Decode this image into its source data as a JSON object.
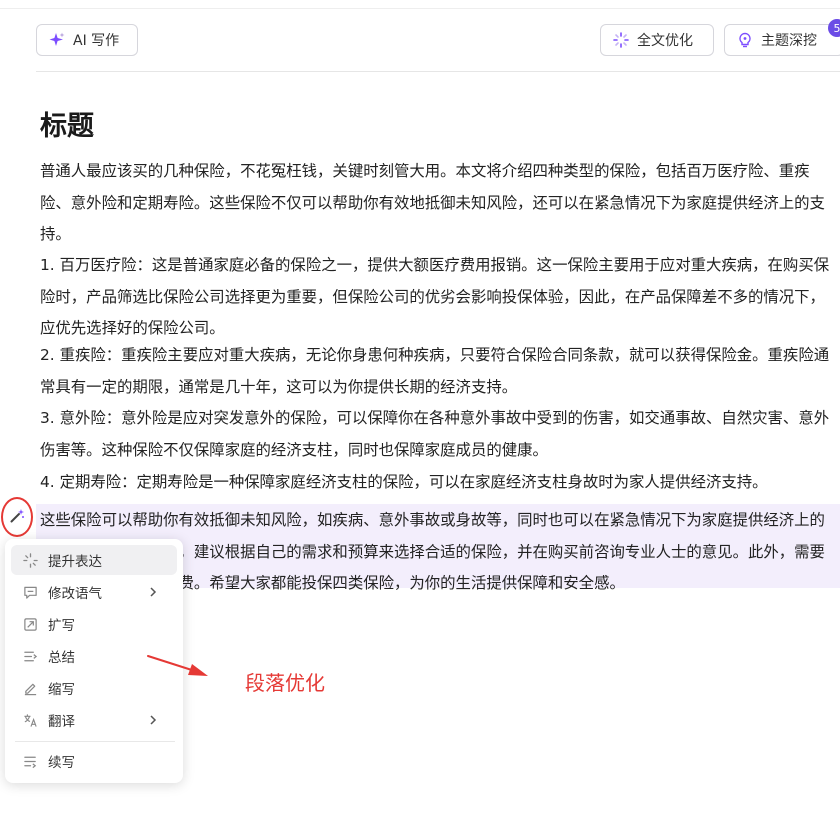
{
  "toolbar": {
    "ai_write": "AI 写作",
    "full_optimize": "全文优化",
    "topic_dig": "主题深挖",
    "badge": "5",
    "accent": "#6b4ce6"
  },
  "document": {
    "title": "标题",
    "paragraphs": [
      "普通人最应该买的几种保险，不花冤枉钱，关键时刻管大用。本文将介绍四种类型的保险，包括百万医疗险、重疾险、意外险和定期寿险。这些保险不仅可以帮助你有效地抵御未知风险，还可以在紧急情况下为家庭提供经济上的支持。",
      "1. 百万医疗险：这是普通家庭必备的保险之一，提供大额医疗费用报销。这一保险主要用于应对重大疾病，在购买保险时，产品筛选比保险公司选择更为重要，但保险公司的优劣会影响投保体验，因此，在产品保障差不多的情况下，应优先选择好的保险公司。",
      "2. 重疾险：重疾险主要应对重大疾病，无论你身患何种疾病，只要符合保险合同条款，就可以获得保险金。重疾险通常具有一定的期限，通常是几十年，这可以为你提供长期的经济支持。",
      "3. 意外险：意外险是应对突发意外的保险，可以保障你在各种意外事故中受到的伤害，如交通事故、自然灾害、意外伤害等。这种保险不仅保障家庭的经济支柱，同时也保障家庭成员的健康。",
      "4. 定期寿险：定期寿险是一种保障家庭经济支柱的保险，可以在家庭经济支柱身故时为家人提供经济支持。",
      "这些保险可以帮助你有效抵御未知风险，如疾病、意外事故或身故等，同时也可以在紧急情况下为家庭提供经济上的支持。在购买保险时，建议根据自己的需求和预算来选择合适的保险，并在购买前咨询专业人士的意见。此外，需要明确保险的本质是消费。希望大家都能投保四类保险，为你的生活提供保障和安全感。"
    ],
    "highlight_color": "#f3eefc"
  },
  "menu": {
    "items": [
      {
        "label": "提升表达",
        "icon": "sparkle-icon",
        "submenu": false
      },
      {
        "label": "修改语气",
        "icon": "chat-icon",
        "submenu": true
      },
      {
        "label": "扩写",
        "icon": "expand-icon",
        "submenu": false
      },
      {
        "label": "总结",
        "icon": "summary-icon",
        "submenu": false
      },
      {
        "label": "缩写",
        "icon": "pen-icon",
        "submenu": false
      },
      {
        "label": "翻译",
        "icon": "translate-icon",
        "submenu": true
      },
      {
        "label": "续写",
        "icon": "continue-icon",
        "submenu": false
      }
    ]
  },
  "annotation": {
    "text": "段落优化",
    "color": "#e53935"
  }
}
